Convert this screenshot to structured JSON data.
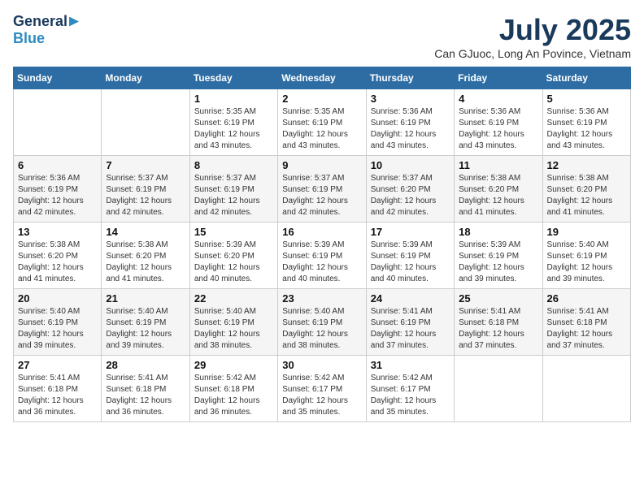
{
  "logo": {
    "general": "General",
    "blue": "Blue"
  },
  "header": {
    "month": "July 2025",
    "location": "Can GJuoc, Long An Povince, Vietnam"
  },
  "days_of_week": [
    "Sunday",
    "Monday",
    "Tuesday",
    "Wednesday",
    "Thursday",
    "Friday",
    "Saturday"
  ],
  "weeks": [
    [
      {
        "day": "",
        "sunrise": "",
        "sunset": "",
        "daylight": ""
      },
      {
        "day": "",
        "sunrise": "",
        "sunset": "",
        "daylight": ""
      },
      {
        "day": "1",
        "sunrise": "Sunrise: 5:35 AM",
        "sunset": "Sunset: 6:19 PM",
        "daylight": "Daylight: 12 hours and 43 minutes."
      },
      {
        "day": "2",
        "sunrise": "Sunrise: 5:35 AM",
        "sunset": "Sunset: 6:19 PM",
        "daylight": "Daylight: 12 hours and 43 minutes."
      },
      {
        "day": "3",
        "sunrise": "Sunrise: 5:36 AM",
        "sunset": "Sunset: 6:19 PM",
        "daylight": "Daylight: 12 hours and 43 minutes."
      },
      {
        "day": "4",
        "sunrise": "Sunrise: 5:36 AM",
        "sunset": "Sunset: 6:19 PM",
        "daylight": "Daylight: 12 hours and 43 minutes."
      },
      {
        "day": "5",
        "sunrise": "Sunrise: 5:36 AM",
        "sunset": "Sunset: 6:19 PM",
        "daylight": "Daylight: 12 hours and 43 minutes."
      }
    ],
    [
      {
        "day": "6",
        "sunrise": "Sunrise: 5:36 AM",
        "sunset": "Sunset: 6:19 PM",
        "daylight": "Daylight: 12 hours and 42 minutes."
      },
      {
        "day": "7",
        "sunrise": "Sunrise: 5:37 AM",
        "sunset": "Sunset: 6:19 PM",
        "daylight": "Daylight: 12 hours and 42 minutes."
      },
      {
        "day": "8",
        "sunrise": "Sunrise: 5:37 AM",
        "sunset": "Sunset: 6:19 PM",
        "daylight": "Daylight: 12 hours and 42 minutes."
      },
      {
        "day": "9",
        "sunrise": "Sunrise: 5:37 AM",
        "sunset": "Sunset: 6:19 PM",
        "daylight": "Daylight: 12 hours and 42 minutes."
      },
      {
        "day": "10",
        "sunrise": "Sunrise: 5:37 AM",
        "sunset": "Sunset: 6:20 PM",
        "daylight": "Daylight: 12 hours and 42 minutes."
      },
      {
        "day": "11",
        "sunrise": "Sunrise: 5:38 AM",
        "sunset": "Sunset: 6:20 PM",
        "daylight": "Daylight: 12 hours and 41 minutes."
      },
      {
        "day": "12",
        "sunrise": "Sunrise: 5:38 AM",
        "sunset": "Sunset: 6:20 PM",
        "daylight": "Daylight: 12 hours and 41 minutes."
      }
    ],
    [
      {
        "day": "13",
        "sunrise": "Sunrise: 5:38 AM",
        "sunset": "Sunset: 6:20 PM",
        "daylight": "Daylight: 12 hours and 41 minutes."
      },
      {
        "day": "14",
        "sunrise": "Sunrise: 5:38 AM",
        "sunset": "Sunset: 6:20 PM",
        "daylight": "Daylight: 12 hours and 41 minutes."
      },
      {
        "day": "15",
        "sunrise": "Sunrise: 5:39 AM",
        "sunset": "Sunset: 6:20 PM",
        "daylight": "Daylight: 12 hours and 40 minutes."
      },
      {
        "day": "16",
        "sunrise": "Sunrise: 5:39 AM",
        "sunset": "Sunset: 6:19 PM",
        "daylight": "Daylight: 12 hours and 40 minutes."
      },
      {
        "day": "17",
        "sunrise": "Sunrise: 5:39 AM",
        "sunset": "Sunset: 6:19 PM",
        "daylight": "Daylight: 12 hours and 40 minutes."
      },
      {
        "day": "18",
        "sunrise": "Sunrise: 5:39 AM",
        "sunset": "Sunset: 6:19 PM",
        "daylight": "Daylight: 12 hours and 39 minutes."
      },
      {
        "day": "19",
        "sunrise": "Sunrise: 5:40 AM",
        "sunset": "Sunset: 6:19 PM",
        "daylight": "Daylight: 12 hours and 39 minutes."
      }
    ],
    [
      {
        "day": "20",
        "sunrise": "Sunrise: 5:40 AM",
        "sunset": "Sunset: 6:19 PM",
        "daylight": "Daylight: 12 hours and 39 minutes."
      },
      {
        "day": "21",
        "sunrise": "Sunrise: 5:40 AM",
        "sunset": "Sunset: 6:19 PM",
        "daylight": "Daylight: 12 hours and 39 minutes."
      },
      {
        "day": "22",
        "sunrise": "Sunrise: 5:40 AM",
        "sunset": "Sunset: 6:19 PM",
        "daylight": "Daylight: 12 hours and 38 minutes."
      },
      {
        "day": "23",
        "sunrise": "Sunrise: 5:40 AM",
        "sunset": "Sunset: 6:19 PM",
        "daylight": "Daylight: 12 hours and 38 minutes."
      },
      {
        "day": "24",
        "sunrise": "Sunrise: 5:41 AM",
        "sunset": "Sunset: 6:19 PM",
        "daylight": "Daylight: 12 hours and 37 minutes."
      },
      {
        "day": "25",
        "sunrise": "Sunrise: 5:41 AM",
        "sunset": "Sunset: 6:18 PM",
        "daylight": "Daylight: 12 hours and 37 minutes."
      },
      {
        "day": "26",
        "sunrise": "Sunrise: 5:41 AM",
        "sunset": "Sunset: 6:18 PM",
        "daylight": "Daylight: 12 hours and 37 minutes."
      }
    ],
    [
      {
        "day": "27",
        "sunrise": "Sunrise: 5:41 AM",
        "sunset": "Sunset: 6:18 PM",
        "daylight": "Daylight: 12 hours and 36 minutes."
      },
      {
        "day": "28",
        "sunrise": "Sunrise: 5:41 AM",
        "sunset": "Sunset: 6:18 PM",
        "daylight": "Daylight: 12 hours and 36 minutes."
      },
      {
        "day": "29",
        "sunrise": "Sunrise: 5:42 AM",
        "sunset": "Sunset: 6:18 PM",
        "daylight": "Daylight: 12 hours and 36 minutes."
      },
      {
        "day": "30",
        "sunrise": "Sunrise: 5:42 AM",
        "sunset": "Sunset: 6:17 PM",
        "daylight": "Daylight: 12 hours and 35 minutes."
      },
      {
        "day": "31",
        "sunrise": "Sunrise: 5:42 AM",
        "sunset": "Sunset: 6:17 PM",
        "daylight": "Daylight: 12 hours and 35 minutes."
      },
      {
        "day": "",
        "sunrise": "",
        "sunset": "",
        "daylight": ""
      },
      {
        "day": "",
        "sunrise": "",
        "sunset": "",
        "daylight": ""
      }
    ]
  ]
}
